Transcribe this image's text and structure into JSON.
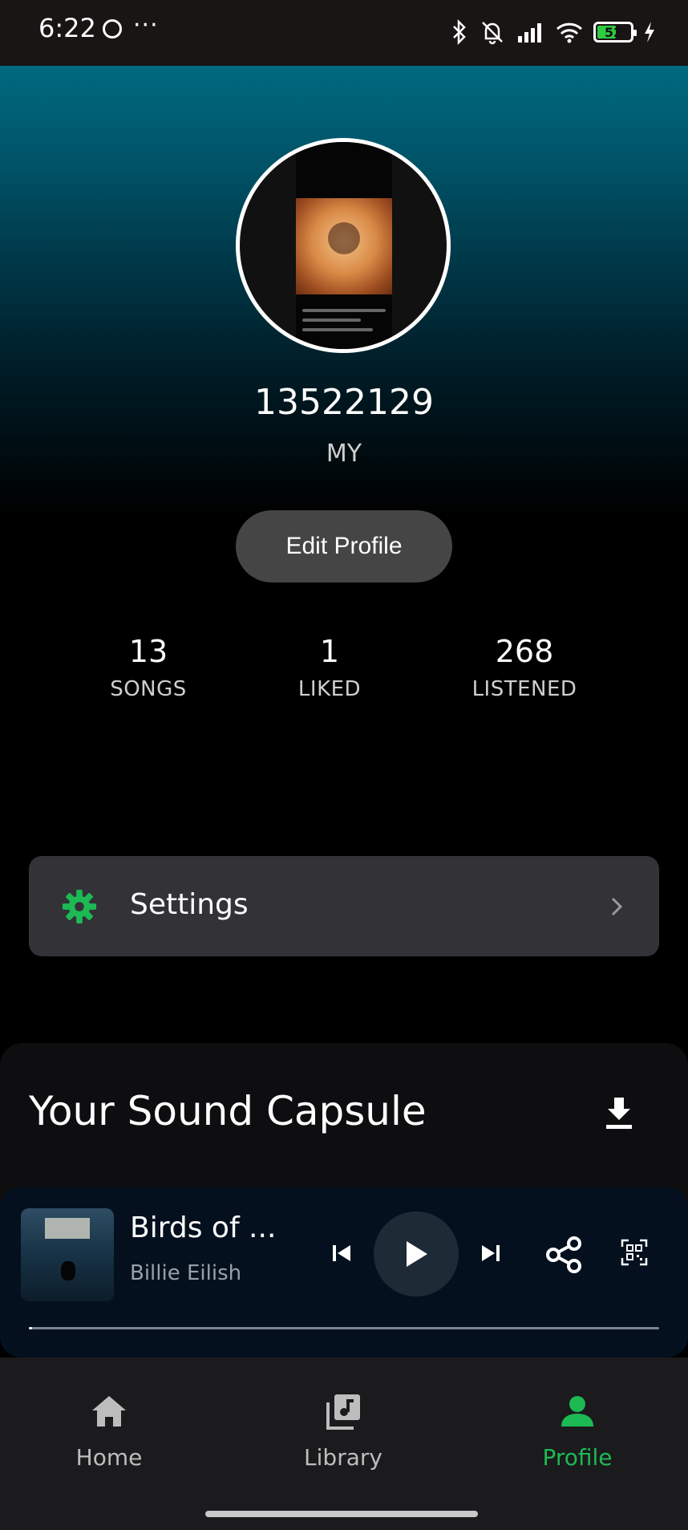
{
  "status_bar": {
    "time": "6:22",
    "dots": "···",
    "battery": "52",
    "battery_level": 0.52
  },
  "profile": {
    "username": "13522129",
    "country": "MY",
    "edit_label": "Edit Profile"
  },
  "stats": [
    {
      "value": "13",
      "label": "SONGS"
    },
    {
      "value": "1",
      "label": "LIKED"
    },
    {
      "value": "268",
      "label": "LISTENED"
    }
  ],
  "settings": {
    "label": "Settings",
    "icon": "gear-icon",
    "accent": "#1db954"
  },
  "capsule": {
    "title": "Your Sound Capsule",
    "icon": "download-icon"
  },
  "player": {
    "title": "Birds of ...",
    "artist": "Billie Eilish",
    "progress": 0.005,
    "icons": [
      "previous-icon",
      "play-icon",
      "next-icon",
      "share-icon",
      "qr-icon"
    ]
  },
  "nav": [
    {
      "label": "Home",
      "icon": "home-icon",
      "active": false
    },
    {
      "label": "Library",
      "icon": "library-icon",
      "active": false
    },
    {
      "label": "Profile",
      "icon": "profile-icon",
      "active": true
    }
  ],
  "colors": {
    "accent": "#1db954",
    "background": "#000000"
  }
}
